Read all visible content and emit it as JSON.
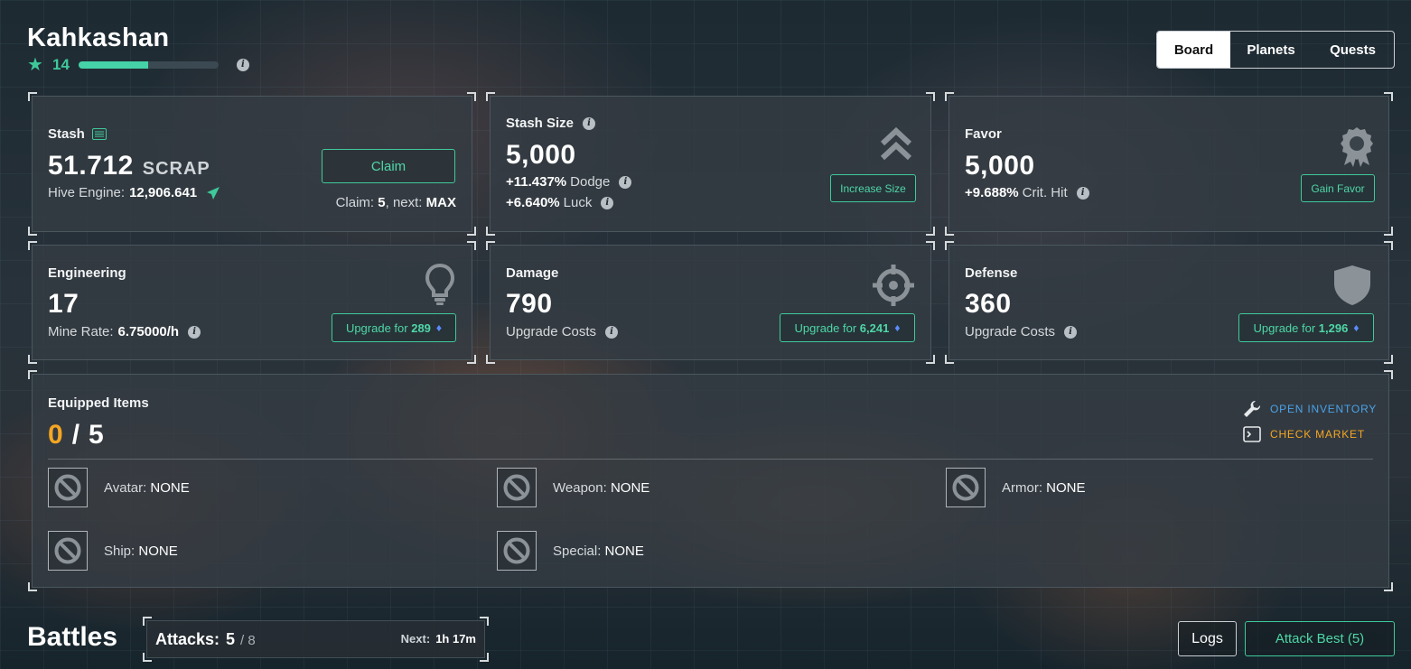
{
  "player": {
    "name": "Kahkashan",
    "level": "14",
    "xp_progress": 0.5
  },
  "tabs": [
    {
      "label": "Board",
      "active": true
    },
    {
      "label": "Planets",
      "active": false
    },
    {
      "label": "Quests",
      "active": false
    }
  ],
  "stash": {
    "label": "Stash",
    "amount": "51.712",
    "unit": "SCRAP",
    "hive_label": "Hive Engine:",
    "hive_value": "12,906.641",
    "claim_button": "Claim",
    "claim_info_label": "Claim:",
    "claim_info_value": "5",
    "next_label": ", next:",
    "next_value": "MAX"
  },
  "stash_size": {
    "label": "Stash Size",
    "value": "5,000",
    "dodge_value": "+11.437%",
    "dodge_label": "Dodge",
    "luck_value": "+6.640%",
    "luck_label": "Luck",
    "button": "Increase Size"
  },
  "favor": {
    "label": "Favor",
    "value": "5,000",
    "crit_value": "+9.688%",
    "crit_label": "Crit. Hit",
    "button": "Gain Favor"
  },
  "engineering": {
    "label": "Engineering",
    "value": "17",
    "mine_label": "Mine Rate:",
    "mine_value": "6.75000/h",
    "button_prefix": "Upgrade for",
    "button_cost": "289"
  },
  "damage": {
    "label": "Damage",
    "value": "790",
    "sub": "Upgrade Costs",
    "button_prefix": "Upgrade for",
    "button_cost": "6,241"
  },
  "defense": {
    "label": "Defense",
    "value": "360",
    "sub": "Upgrade Costs",
    "button_prefix": "Upgrade for",
    "button_cost": "1,296"
  },
  "equipped": {
    "label": "Equipped Items",
    "count": "0",
    "separator": "/",
    "max": "5",
    "open_inventory": "OPEN INVENTORY",
    "check_market": "CHECK MARKET",
    "slots": [
      {
        "label": "Avatar:",
        "value": "NONE"
      },
      {
        "label": "Weapon:",
        "value": "NONE"
      },
      {
        "label": "Armor:",
        "value": "NONE"
      },
      {
        "label": "Ship:",
        "value": "NONE"
      },
      {
        "label": "Special:",
        "value": "NONE"
      }
    ]
  },
  "battles": {
    "title": "Battles",
    "attacks_label": "Attacks:",
    "attacks_value": "5",
    "attacks_max": "/ 8",
    "next_label": "Next:",
    "next_value": "1h 17m",
    "logs_button": "Logs",
    "attack_best_button": "Attack Best (5)"
  },
  "colors": {
    "accent": "#3fc99a",
    "orange": "#f5a623",
    "link_blue": "#4aa3e8",
    "gem_blue": "#5b8cff"
  }
}
